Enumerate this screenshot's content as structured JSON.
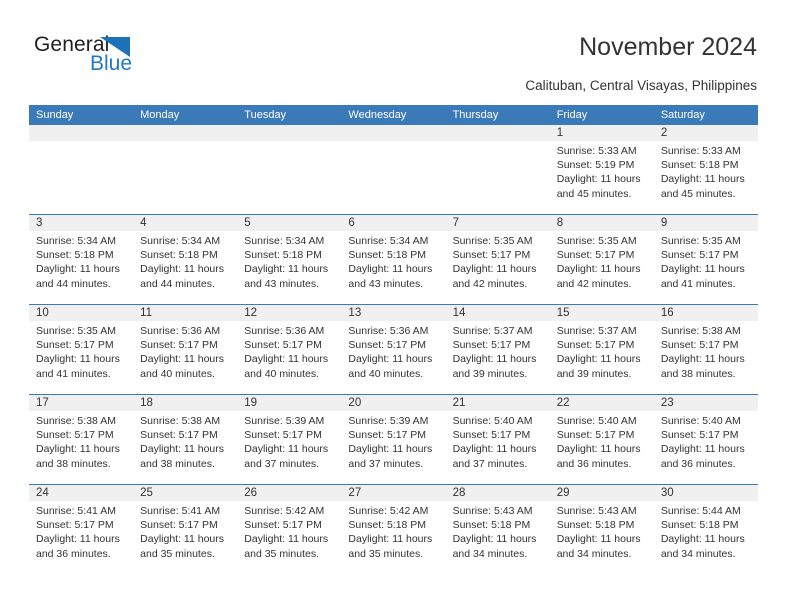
{
  "brand": {
    "name_part1": "General",
    "name_part2": "Blue",
    "triangle_color": "#1b72b8",
    "blue_text_color": "#2079c3"
  },
  "header": {
    "title": "November 2024",
    "subtitle": "Calituban, Central Visayas, Philippines"
  },
  "theme": {
    "header_blue": "#3a7ab9",
    "daynum_band": "#f0f0f0",
    "text": "#333333"
  },
  "weekdays": [
    "Sunday",
    "Monday",
    "Tuesday",
    "Wednesday",
    "Thursday",
    "Friday",
    "Saturday"
  ],
  "weeks": [
    [
      {
        "day": "",
        "sunrise": "",
        "sunset": "",
        "daylight1": "",
        "daylight2": "",
        "empty": true
      },
      {
        "day": "",
        "sunrise": "",
        "sunset": "",
        "daylight1": "",
        "daylight2": "",
        "empty": true
      },
      {
        "day": "",
        "sunrise": "",
        "sunset": "",
        "daylight1": "",
        "daylight2": "",
        "empty": true
      },
      {
        "day": "",
        "sunrise": "",
        "sunset": "",
        "daylight1": "",
        "daylight2": "",
        "empty": true
      },
      {
        "day": "",
        "sunrise": "",
        "sunset": "",
        "daylight1": "",
        "daylight2": "",
        "empty": true
      },
      {
        "day": "1",
        "sunrise": "Sunrise: 5:33 AM",
        "sunset": "Sunset: 5:19 PM",
        "daylight1": "Daylight: 11 hours",
        "daylight2": "and 45 minutes.",
        "empty": false
      },
      {
        "day": "2",
        "sunrise": "Sunrise: 5:33 AM",
        "sunset": "Sunset: 5:18 PM",
        "daylight1": "Daylight: 11 hours",
        "daylight2": "and 45 minutes.",
        "empty": false
      }
    ],
    [
      {
        "day": "3",
        "sunrise": "Sunrise: 5:34 AM",
        "sunset": "Sunset: 5:18 PM",
        "daylight1": "Daylight: 11 hours",
        "daylight2": "and 44 minutes.",
        "empty": false
      },
      {
        "day": "4",
        "sunrise": "Sunrise: 5:34 AM",
        "sunset": "Sunset: 5:18 PM",
        "daylight1": "Daylight: 11 hours",
        "daylight2": "and 44 minutes.",
        "empty": false
      },
      {
        "day": "5",
        "sunrise": "Sunrise: 5:34 AM",
        "sunset": "Sunset: 5:18 PM",
        "daylight1": "Daylight: 11 hours",
        "daylight2": "and 43 minutes.",
        "empty": false
      },
      {
        "day": "6",
        "sunrise": "Sunrise: 5:34 AM",
        "sunset": "Sunset: 5:18 PM",
        "daylight1": "Daylight: 11 hours",
        "daylight2": "and 43 minutes.",
        "empty": false
      },
      {
        "day": "7",
        "sunrise": "Sunrise: 5:35 AM",
        "sunset": "Sunset: 5:17 PM",
        "daylight1": "Daylight: 11 hours",
        "daylight2": "and 42 minutes.",
        "empty": false
      },
      {
        "day": "8",
        "sunrise": "Sunrise: 5:35 AM",
        "sunset": "Sunset: 5:17 PM",
        "daylight1": "Daylight: 11 hours",
        "daylight2": "and 42 minutes.",
        "empty": false
      },
      {
        "day": "9",
        "sunrise": "Sunrise: 5:35 AM",
        "sunset": "Sunset: 5:17 PM",
        "daylight1": "Daylight: 11 hours",
        "daylight2": "and 41 minutes.",
        "empty": false
      }
    ],
    [
      {
        "day": "10",
        "sunrise": "Sunrise: 5:35 AM",
        "sunset": "Sunset: 5:17 PM",
        "daylight1": "Daylight: 11 hours",
        "daylight2": "and 41 minutes.",
        "empty": false
      },
      {
        "day": "11",
        "sunrise": "Sunrise: 5:36 AM",
        "sunset": "Sunset: 5:17 PM",
        "daylight1": "Daylight: 11 hours",
        "daylight2": "and 40 minutes.",
        "empty": false
      },
      {
        "day": "12",
        "sunrise": "Sunrise: 5:36 AM",
        "sunset": "Sunset: 5:17 PM",
        "daylight1": "Daylight: 11 hours",
        "daylight2": "and 40 minutes.",
        "empty": false
      },
      {
        "day": "13",
        "sunrise": "Sunrise: 5:36 AM",
        "sunset": "Sunset: 5:17 PM",
        "daylight1": "Daylight: 11 hours",
        "daylight2": "and 40 minutes.",
        "empty": false
      },
      {
        "day": "14",
        "sunrise": "Sunrise: 5:37 AM",
        "sunset": "Sunset: 5:17 PM",
        "daylight1": "Daylight: 11 hours",
        "daylight2": "and 39 minutes.",
        "empty": false
      },
      {
        "day": "15",
        "sunrise": "Sunrise: 5:37 AM",
        "sunset": "Sunset: 5:17 PM",
        "daylight1": "Daylight: 11 hours",
        "daylight2": "and 39 minutes.",
        "empty": false
      },
      {
        "day": "16",
        "sunrise": "Sunrise: 5:38 AM",
        "sunset": "Sunset: 5:17 PM",
        "daylight1": "Daylight: 11 hours",
        "daylight2": "and 38 minutes.",
        "empty": false
      }
    ],
    [
      {
        "day": "17",
        "sunrise": "Sunrise: 5:38 AM",
        "sunset": "Sunset: 5:17 PM",
        "daylight1": "Daylight: 11 hours",
        "daylight2": "and 38 minutes.",
        "empty": false
      },
      {
        "day": "18",
        "sunrise": "Sunrise: 5:38 AM",
        "sunset": "Sunset: 5:17 PM",
        "daylight1": "Daylight: 11 hours",
        "daylight2": "and 38 minutes.",
        "empty": false
      },
      {
        "day": "19",
        "sunrise": "Sunrise: 5:39 AM",
        "sunset": "Sunset: 5:17 PM",
        "daylight1": "Daylight: 11 hours",
        "daylight2": "and 37 minutes.",
        "empty": false
      },
      {
        "day": "20",
        "sunrise": "Sunrise: 5:39 AM",
        "sunset": "Sunset: 5:17 PM",
        "daylight1": "Daylight: 11 hours",
        "daylight2": "and 37 minutes.",
        "empty": false
      },
      {
        "day": "21",
        "sunrise": "Sunrise: 5:40 AM",
        "sunset": "Sunset: 5:17 PM",
        "daylight1": "Daylight: 11 hours",
        "daylight2": "and 37 minutes.",
        "empty": false
      },
      {
        "day": "22",
        "sunrise": "Sunrise: 5:40 AM",
        "sunset": "Sunset: 5:17 PM",
        "daylight1": "Daylight: 11 hours",
        "daylight2": "and 36 minutes.",
        "empty": false
      },
      {
        "day": "23",
        "sunrise": "Sunrise: 5:40 AM",
        "sunset": "Sunset: 5:17 PM",
        "daylight1": "Daylight: 11 hours",
        "daylight2": "and 36 minutes.",
        "empty": false
      }
    ],
    [
      {
        "day": "24",
        "sunrise": "Sunrise: 5:41 AM",
        "sunset": "Sunset: 5:17 PM",
        "daylight1": "Daylight: 11 hours",
        "daylight2": "and 36 minutes.",
        "empty": false
      },
      {
        "day": "25",
        "sunrise": "Sunrise: 5:41 AM",
        "sunset": "Sunset: 5:17 PM",
        "daylight1": "Daylight: 11 hours",
        "daylight2": "and 35 minutes.",
        "empty": false
      },
      {
        "day": "26",
        "sunrise": "Sunrise: 5:42 AM",
        "sunset": "Sunset: 5:17 PM",
        "daylight1": "Daylight: 11 hours",
        "daylight2": "and 35 minutes.",
        "empty": false
      },
      {
        "day": "27",
        "sunrise": "Sunrise: 5:42 AM",
        "sunset": "Sunset: 5:18 PM",
        "daylight1": "Daylight: 11 hours",
        "daylight2": "and 35 minutes.",
        "empty": false
      },
      {
        "day": "28",
        "sunrise": "Sunrise: 5:43 AM",
        "sunset": "Sunset: 5:18 PM",
        "daylight1": "Daylight: 11 hours",
        "daylight2": "and 34 minutes.",
        "empty": false
      },
      {
        "day": "29",
        "sunrise": "Sunrise: 5:43 AM",
        "sunset": "Sunset: 5:18 PM",
        "daylight1": "Daylight: 11 hours",
        "daylight2": "and 34 minutes.",
        "empty": false
      },
      {
        "day": "30",
        "sunrise": "Sunrise: 5:44 AM",
        "sunset": "Sunset: 5:18 PM",
        "daylight1": "Daylight: 11 hours",
        "daylight2": "and 34 minutes.",
        "empty": false
      }
    ]
  ]
}
